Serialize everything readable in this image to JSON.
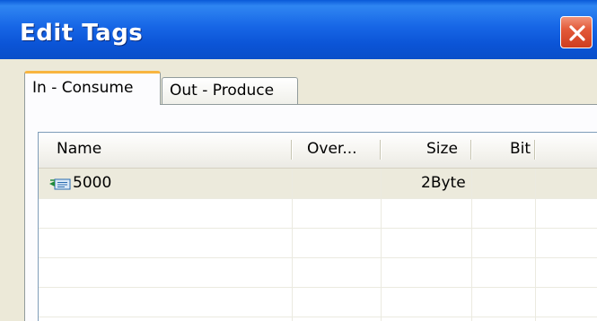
{
  "window": {
    "title": "Edit Tags"
  },
  "tabs": [
    {
      "label": "In - Consume",
      "active": true
    },
    {
      "label": "Out - Produce",
      "active": false
    }
  ],
  "table": {
    "columns": [
      "Name",
      "Over...",
      "Size",
      "Bit"
    ],
    "rows": [
      {
        "name": "5000",
        "over": "",
        "size": "2Byte",
        "bit": "",
        "icon": "tag-icon",
        "selected": true
      }
    ]
  },
  "colors": {
    "titlebar": "#0b54d6",
    "close_button": "#e35a3a",
    "active_tab_accent": "#f8b540",
    "selected_row": "#eceadc"
  }
}
